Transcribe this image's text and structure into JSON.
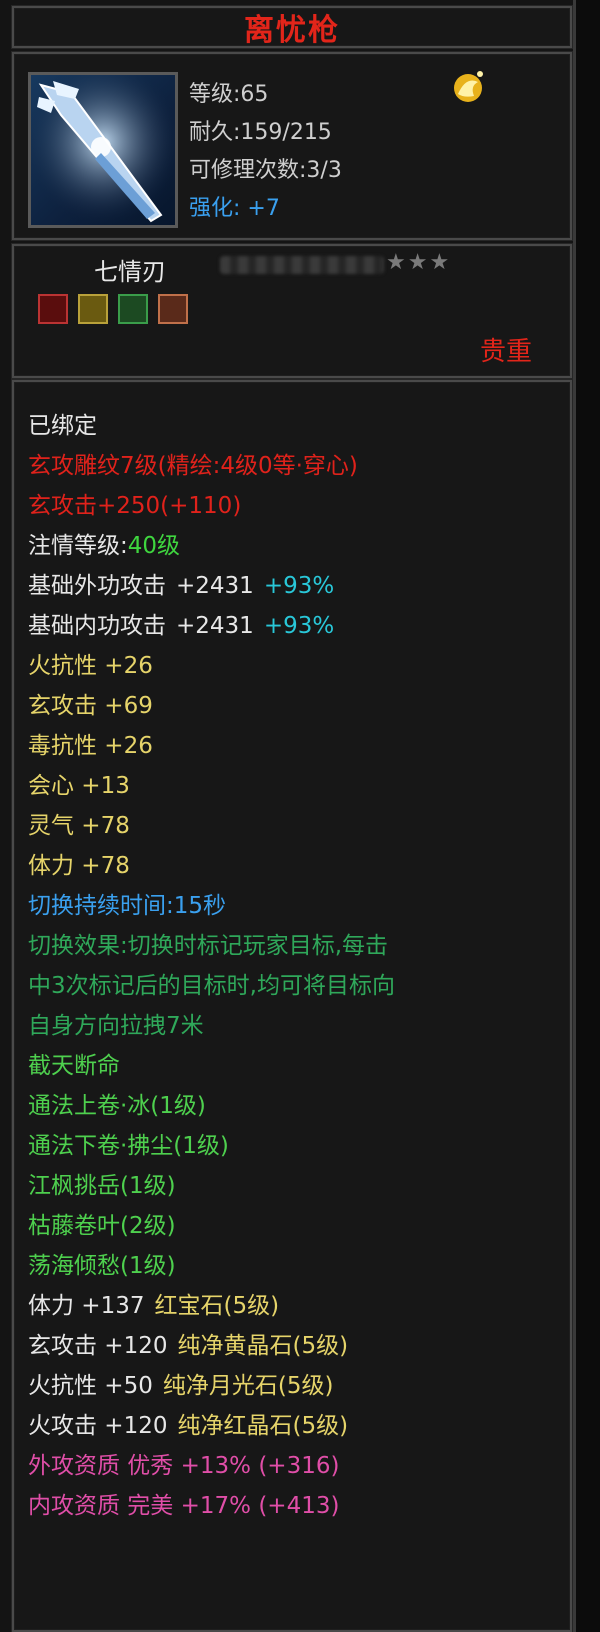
{
  "title": "离忧枪",
  "head": {
    "level": "等级:65",
    "durability": "耐久:159/215",
    "repairs": "可修理次数:3/3",
    "enhance_label": "强化:",
    "enhance_value": "+7"
  },
  "sub": {
    "name": "七情刃",
    "stars": "★★★",
    "precious": "贵重"
  },
  "attrs": {
    "bound": "已绑定",
    "line1": "玄攻雕纹7级(精绘:4级0等·穿心)",
    "line2": "玄攻击+250(+110)",
    "zhuqing_label": "注情等级:",
    "zhuqing_value": "40级",
    "outer_label": "基础外功攻击",
    "outer_value": "+2431",
    "outer_pct": "+93%",
    "inner_label": "基础内功攻击",
    "inner_value": "+2431",
    "inner_pct": "+93%",
    "a1": "火抗性 +26",
    "a2": "玄攻击 +69",
    "a3": "毒抗性 +26",
    "a4": "会心 +13",
    "a5": "灵气 +78",
    "a6": "体力 +78",
    "switch_time": "切换持续时间:15秒",
    "switch_effect_1": "切换效果:切换时标记玩家目标,每击",
    "switch_effect_2": "中3次标记后的目标时,均可将目标向",
    "switch_effect_3": "自身方向拉拽7米",
    "s1": "截天断命",
    "s2": "通法上卷·冰(1级)",
    "s3": "通法下卷·拂尘(1级)",
    "s4": "江枫挑岳(1级)",
    "s5": "枯藤卷叶(2级)",
    "s6": "荡海倾愁(1级)",
    "gem1_stat": "体力 +137",
    "gem1_name": "红宝石(5级)",
    "gem2_stat": "玄攻击 +120",
    "gem2_name": "纯净黄晶石(5级)",
    "gem3_stat": "火抗性 +50",
    "gem3_name": "纯净月光石(5级)",
    "gem4_stat": "火攻击 +120",
    "gem4_name": "纯净红晶石(5级)",
    "q1": "外攻资质  优秀 +13% (+316)",
    "q2": "内攻资质  完美 +17% (+413)"
  },
  "colors": {
    "red": "#e0221b",
    "green": "#3fd63f",
    "cyan": "#29c7d8",
    "yellow": "#e6d46a",
    "blue": "#3aa0ef",
    "pink": "#e04ea8"
  }
}
